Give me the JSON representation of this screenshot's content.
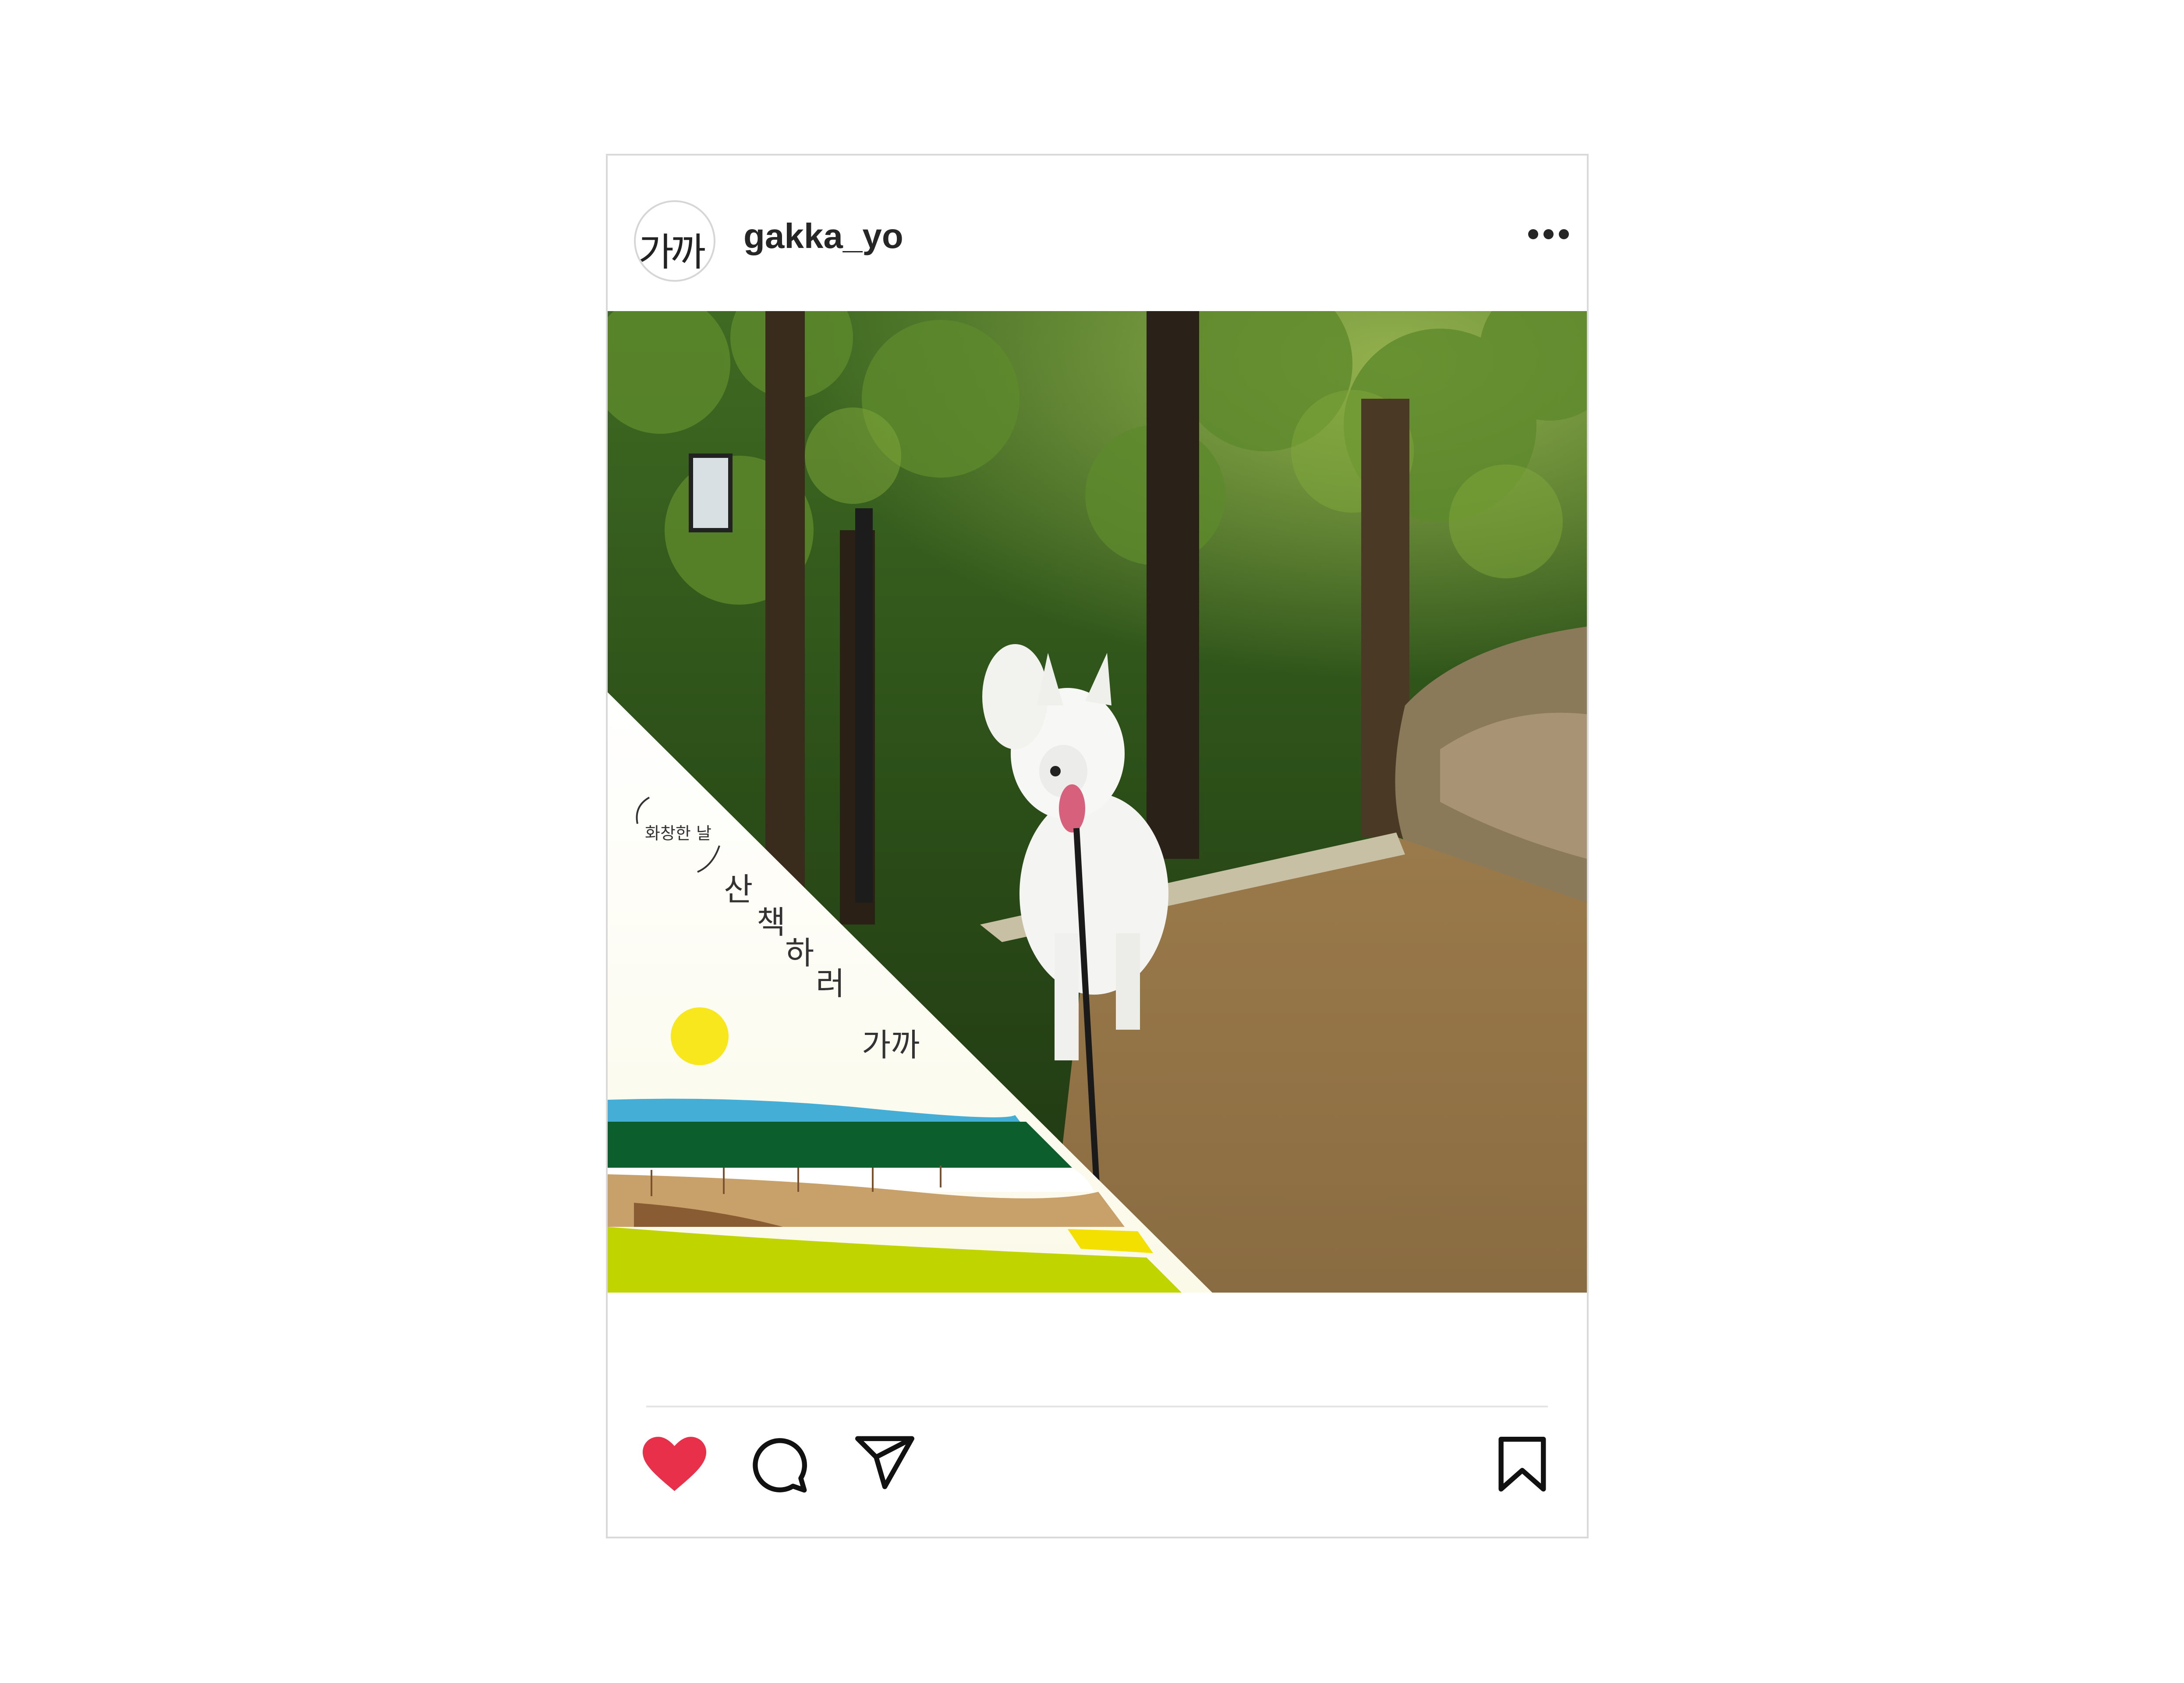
{
  "post": {
    "username": "gakka_yo",
    "avatar_text": "가까",
    "more_icon": "more-horizontal-icon",
    "image": {
      "overlay_subtitle": "화창한 날",
      "overlay_title_chars": [
        "산",
        "책",
        "하",
        "러"
      ],
      "overlay_title_tail": "가까"
    },
    "actions": {
      "like": "heart-icon",
      "like_color": "#e8304a",
      "comment": "comment-icon",
      "share": "send-icon",
      "save": "bookmark-icon"
    }
  }
}
